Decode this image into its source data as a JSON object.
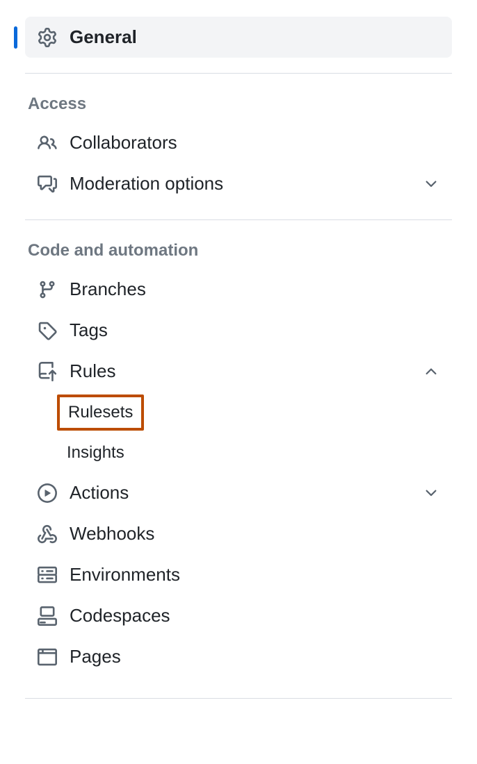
{
  "selected": {
    "label": "General"
  },
  "sections": {
    "access": {
      "heading": "Access",
      "items": {
        "collaborators": "Collaborators",
        "moderation": "Moderation options"
      }
    },
    "code": {
      "heading": "Code and automation",
      "items": {
        "branches": "Branches",
        "tags": "Tags",
        "rules": "Rules",
        "actions": "Actions",
        "webhooks": "Webhooks",
        "environments": "Environments",
        "codespaces": "Codespaces",
        "pages": "Pages"
      },
      "rules_sub": {
        "rulesets": "Rulesets",
        "insights": "Insights"
      }
    }
  }
}
